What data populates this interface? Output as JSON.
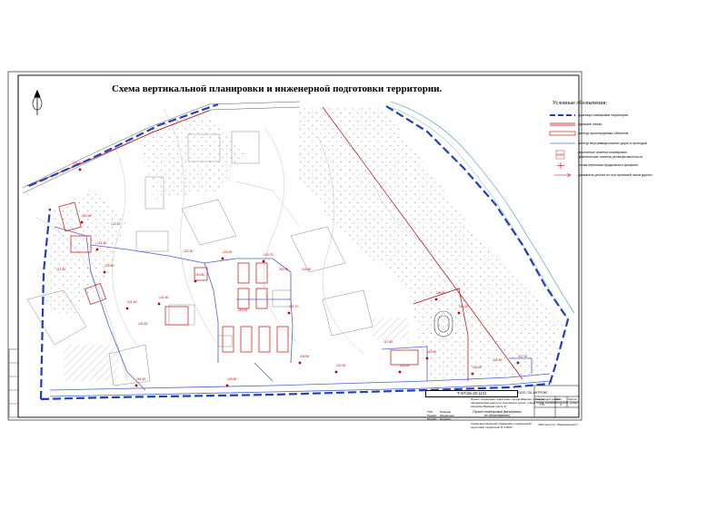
{
  "title": "Схема вертикальной планировки и инженерной подготовки территории.",
  "legend": {
    "heading": "Условные обозначения:",
    "items": [
      {
        "label": "- граница планировки территории",
        "color": "#1f3fbf"
      },
      {
        "label": "- красные линии",
        "color": "#c00000"
      },
      {
        "label": "- контур проектируемых объектов",
        "color": "#d04040"
      },
      {
        "label": "- контур внутриквартальных дорог и проездов",
        "color": "#5a6fd8"
      },
      {
        "label": "- проектные отметки планировки",
        "color": "#c00000"
      },
      {
        "label": "- фактические отметки рельефа местности",
        "color": "#c00000"
      },
      {
        "label": "- точка перелома продольного профиля",
        "color": "#c00000"
      },
      {
        "label": "- указатель уклона по оси проезжей части дороги",
        "color": "#c00000"
      }
    ]
  },
  "title_block": {
    "code": "Т-57/15-20 (21)",
    "company": "ООО \"СК АНТРОМ\"",
    "project_desc": "Проект планировки территории города Иваново, ограниченной новым направлением дороги от Кохомского шоссе, улицы Ухтом, Кохомского шоссе, улицы Кохомско-Баумана (часть 1)",
    "doc_name": "Проект планировки (материалы по обоснованию)",
    "stage_label": "Стадия",
    "sheet_label": "Лист",
    "sheets_label": "Листов",
    "stage": "ПП",
    "sheet": "3",
    "drawing_name": "Схема вертикальной планировки и инженерной подготовки территории М 1:2000",
    "org": "ОАО институт \"Ивановопроект\"",
    "roles": [
      "ГИП",
      "Разраб.",
      "Разраб."
    ],
    "names": [
      "Павлова",
      "Михайлова",
      "Куприна"
    ]
  },
  "plan_labels": [
    "121.00",
    "120.90",
    "121.30",
    "120.80",
    "121.40",
    "121.50",
    "119.80",
    "120.00",
    "120.70",
    "121.70",
    "118.90",
    "121.90",
    "122.00",
    "119.50",
    "118.20",
    "117.10",
    "118.80",
    "119.00",
    "116.40",
    "120.50",
    "117.40",
    "121.20",
    "122.30",
    "119.90",
    "117.80",
    "116.90",
    "119.20",
    "120.60",
    "120.40"
  ]
}
